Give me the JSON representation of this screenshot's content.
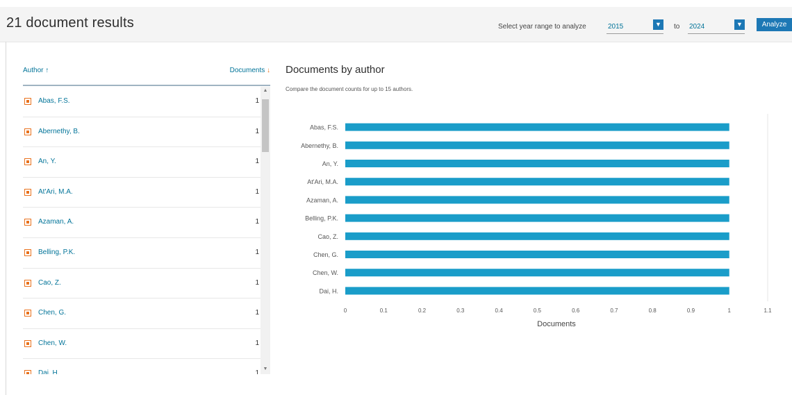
{
  "header": {
    "title": "21 document results",
    "year_range_label": "Select year range to analyze",
    "year_from": "2015",
    "to_label": "to",
    "year_to": "2024",
    "analyze_label": "Analyze"
  },
  "author_list": {
    "author_header": "Author",
    "documents_header": "Documents",
    "rows": [
      {
        "name": "Abas, F.S.",
        "count": "1"
      },
      {
        "name": "Abernethy, B.",
        "count": "1"
      },
      {
        "name": "An, Y.",
        "count": "1"
      },
      {
        "name": "At'Ari, M.A.",
        "count": "1"
      },
      {
        "name": "Azaman, A.",
        "count": "1"
      },
      {
        "name": "Belling, P.K.",
        "count": "1"
      },
      {
        "name": "Cao, Z.",
        "count": "1"
      },
      {
        "name": "Chen, G.",
        "count": "1"
      },
      {
        "name": "Chen, W.",
        "count": "1"
      },
      {
        "name": "Dai, H.",
        "count": "1"
      }
    ]
  },
  "chart": {
    "title": "Documents by author",
    "subtitle": "Compare the document counts for up to 15 authors."
  },
  "chart_data": {
    "type": "bar",
    "orientation": "horizontal",
    "categories": [
      "Abas, F.S.",
      "Abernethy, B.",
      "An, Y.",
      "At'Ari, M.A.",
      "Azaman, A.",
      "Belling, P.K.",
      "Cao, Z.",
      "Chen, G.",
      "Chen, W.",
      "Dai, H."
    ],
    "values": [
      1,
      1,
      1,
      1,
      1,
      1,
      1,
      1,
      1,
      1
    ],
    "xlabel": "Documents",
    "ylabel": "",
    "xlim": [
      0,
      1.1
    ],
    "xticks": [
      "0",
      "0.1",
      "0.2",
      "0.3",
      "0.4",
      "0.5",
      "0.6",
      "0.7",
      "0.8",
      "0.9",
      "1",
      "1.1"
    ],
    "bar_color": "#1a9dc9",
    "grid": false
  },
  "colors": {
    "link": "#007398",
    "accent": "#e9711c",
    "button": "#1d78b5",
    "bar": "#1a9dc9"
  }
}
